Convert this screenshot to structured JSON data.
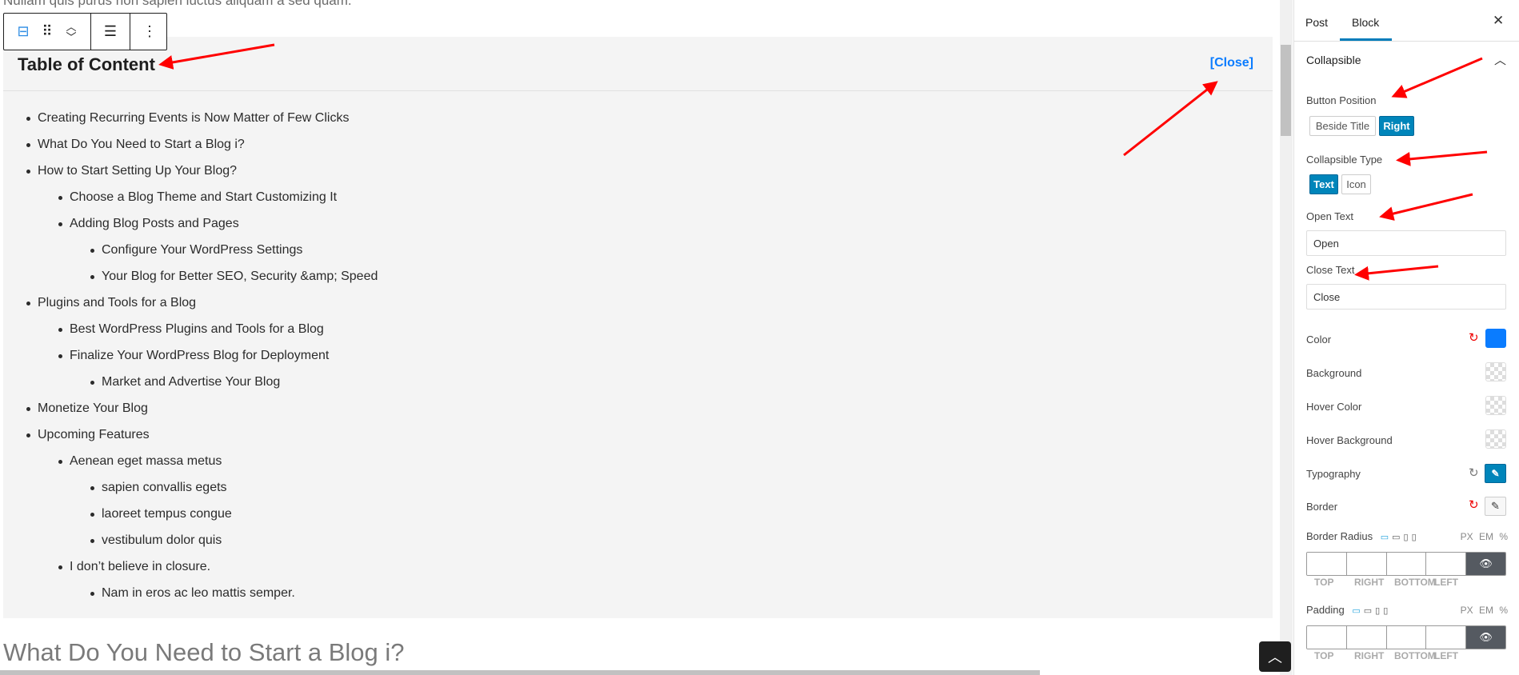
{
  "editor": {
    "intro_text": "Nullam quis purus non sapien luctus aliquam a sed quam.",
    "toolbar": {
      "icons": [
        "block-type-icon",
        "drag-handle-icon",
        "move-up-down-icon",
        "align-icon",
        "more-options-icon"
      ]
    },
    "toc": {
      "title": "Table of Content",
      "close_link": "[Close]",
      "items": [
        {
          "level": 1,
          "text": "Creating Recurring Events is Now Matter of Few Clicks"
        },
        {
          "level": 1,
          "text": "What Do You Need to Start a Blog i?"
        },
        {
          "level": 1,
          "text": "How to Start Setting Up Your Blog?"
        },
        {
          "level": 2,
          "text": "Choose a Blog Theme and Start Customizing It"
        },
        {
          "level": 2,
          "text": "Adding Blog Posts and Pages"
        },
        {
          "level": 3,
          "text": "Configure Your WordPress Settings"
        },
        {
          "level": 3,
          "text": "Your Blog for Better SEO, Security &amp; Speed"
        },
        {
          "level": 1,
          "text": "Plugins and Tools for a Blog"
        },
        {
          "level": 2,
          "text": "Best WordPress Plugins and Tools for a Blog"
        },
        {
          "level": 2,
          "text": "Finalize Your WordPress Blog for Deployment"
        },
        {
          "level": 3,
          "text": "Market and Advertise Your Blog"
        },
        {
          "level": 1,
          "text": "Monetize Your Blog"
        },
        {
          "level": 1,
          "text": "Upcoming Features"
        },
        {
          "level": 2,
          "text": "Aenean eget massa metus"
        },
        {
          "level": 3,
          "text": "sapien convallis egets"
        },
        {
          "level": 3,
          "text": "laoreet tempus congue"
        },
        {
          "level": 3,
          "text": "vestibulum dolor quis"
        },
        {
          "level": 2,
          "text": "I don’t believe in closure."
        },
        {
          "level": 3,
          "text": "Nam in eros ac leo mattis semper."
        }
      ]
    },
    "next_heading": "What Do You Need to Start a Blog i?"
  },
  "sidebar": {
    "tabs": [
      {
        "label": "Post",
        "active": false
      },
      {
        "label": "Block",
        "active": true
      }
    ],
    "panel_title": "Collapsible",
    "button_position": {
      "label": "Button Position",
      "options": [
        "Beside Title",
        "Right"
      ],
      "selected": "Right"
    },
    "collapsible_type": {
      "label": "Collapsible Type",
      "options": [
        "Text",
        "Icon"
      ],
      "selected": "Text"
    },
    "open_text": {
      "label": "Open Text",
      "value": "Open"
    },
    "close_text": {
      "label": "Close Text",
      "value": "Close"
    },
    "color": {
      "label": "Color",
      "value": "#0a7cff"
    },
    "background": {
      "label": "Background"
    },
    "hover_color": {
      "label": "Hover Color"
    },
    "hover_background": {
      "label": "Hover Background"
    },
    "typography": {
      "label": "Typography"
    },
    "border": {
      "label": "Border"
    },
    "border_radius": {
      "label": "Border Radius",
      "units": "PX EM %",
      "sides": [
        "TOP",
        "RIGHT",
        "BOTTOM",
        "LEFT"
      ]
    },
    "padding": {
      "label": "Padding",
      "units": "PX EM %",
      "sides": [
        "TOP",
        "RIGHT",
        "BOTTOM",
        "LEFT"
      ]
    }
  },
  "colors": {
    "accent": "#007cba",
    "link": "#0a7cff",
    "annotation": "#ff0000"
  }
}
